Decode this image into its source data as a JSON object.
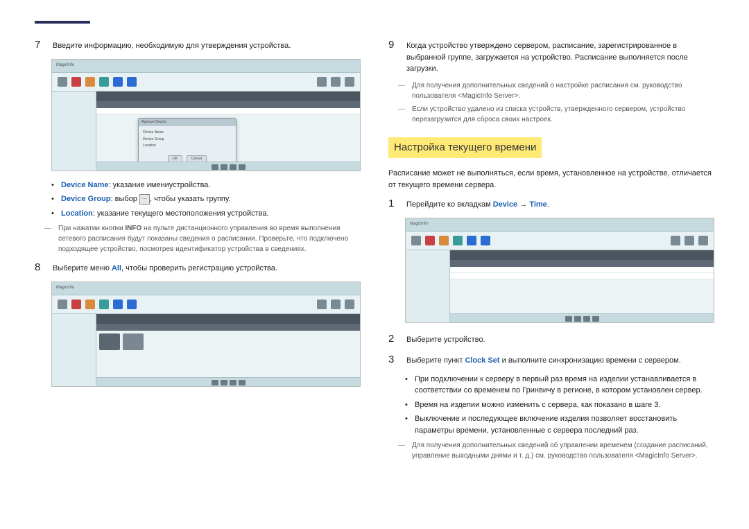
{
  "left": {
    "step7": "Введите информацию, необходимую для утверждения устройства.",
    "bullets": {
      "devname_label": "Device Name",
      "devname_text": ": указание имениустройства.",
      "devgroup_label": "Device Group",
      "devgroup_text_a": ": выбор ",
      "devgroup_text_b": ", чтобы указать группу.",
      "location_label": "Location",
      "location_text": ": указание текущего местоположения устройства."
    },
    "note": "При нажатии кнопки INFO на пульте дистанционного управления во время выполнения сетевого расписания будут показаны сведения о расписании. Проверьте, что подключено подходящее устройство, посмотрев идентификатор устройства в сведениях.",
    "info_bold": "INFO",
    "step8_a": "Выберите меню ",
    "step8_all": "All",
    "step8_b": ", чтобы проверить регистрацию устройства.",
    "ss_logo": "MagicInfo",
    "dialog": {
      "title": "Approve Device",
      "f1": "Device Name",
      "f2": "Device Group",
      "f3": "Location",
      "ok": "OK",
      "cancel": "Cancel"
    }
  },
  "right": {
    "step9": "Когда устройство утверждено сервером, расписание, зарегистрированное в выбранной группе, загружается на устройство. Расписание выполняется после загрузки.",
    "notes9": {
      "a": "Для получения дополнительных сведений о настройке расписания см. руководство пользователя <MagicInfo Server>.",
      "b": "Если устройство удалено из списка устройств, утвержденного сервером, устройство перезагрузится для сброса своих настроек."
    },
    "heading": "Настройка текущего времени",
    "intro": "Расписание может не выполняться, если время, установленное на устройстве, отличается от текущего времени сервера.",
    "step1_a": "Перейдите ко вкладкам ",
    "step1_device": "Device",
    "step1_arrow": " → ",
    "step1_time": "Time",
    "step1_end": ".",
    "step2": "Выберите устройство.",
    "step3_a": "Выберите пункт ",
    "step3_clock": "Clock Set",
    "step3_b": " и выполните синхронизацию времени с сервером.",
    "bullets3": {
      "a": "При подключении к серверу в первый раз время на изделии устанавливается в соответствии со временем по Гринвичу в регионе, в котором установлен сервер.",
      "b": "Время на изделии можно изменить с сервера, как показано в шаге 3.",
      "c": "Выключение и последующее включение изделия позволяет восстановить параметры времени, установленные с сервера последний раз."
    },
    "notes_end": "Для получения дополнительных сведений об управлении временем (создание расписаний, управление выходными днями и т. д.) см. руководство пользователя <MagicInfo Server>."
  }
}
